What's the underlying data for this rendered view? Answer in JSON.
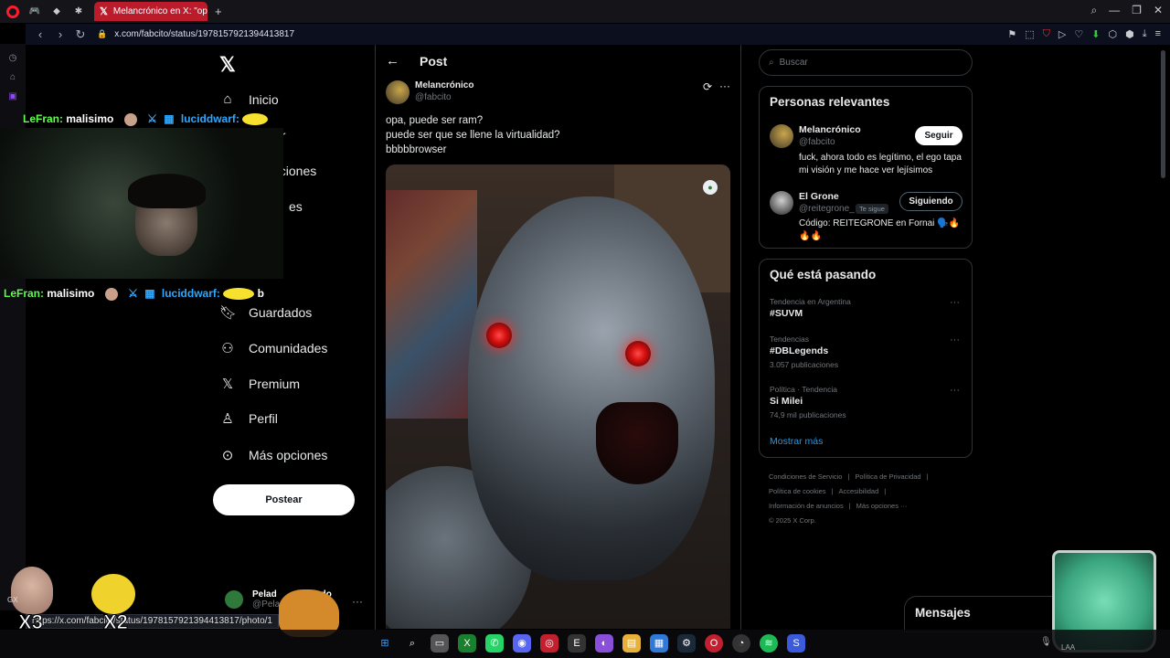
{
  "browser": {
    "tab_title": "Melancrónico en X: \"opa,",
    "url": "x.com/fabcito/status/1978157921394413817",
    "status_url": "https://x.com/fabcito/status/1978157921394413817/photo/1"
  },
  "x_nav": {
    "items": [
      {
        "label": "Inicio",
        "icon": "home-icon"
      },
      {
        "label": "Guardados",
        "icon": "bookmark-icon"
      },
      {
        "label": "Comunidades",
        "icon": "communities-icon"
      },
      {
        "label": "Premium",
        "icon": "x-icon"
      },
      {
        "label": "Perfil",
        "icon": "user-icon"
      },
      {
        "label": "Más opciones",
        "icon": "more-icon"
      }
    ],
    "partial_items": [
      "ar",
      "aciones",
      "es"
    ],
    "post_button": "Postear",
    "account_name": "Pelad",
    "account_name_tail": "astardo",
    "account_handle": "@Pelad",
    "account_handle_tail": "da"
  },
  "stream_overlay": {
    "chat1_user": "LeFran:",
    "chat1_msg": "malisimo",
    "chat1_user2": "luciddwarf:",
    "chat2_user": "LeFran:",
    "chat2_msg": "malisimo",
    "chat2_user2": "luciddwarf:",
    "chat2_tail": "b",
    "multiplier_a": "X3",
    "multiplier_b": "X2",
    "gx": "GX"
  },
  "post": {
    "header": "Post",
    "author_name": "Melancrónico",
    "author_handle": "@fabcito",
    "text_lines": [
      "opa, puede ser ram?",
      "puede ser que se llene la virtualidad?",
      "bbbbbrowser"
    ]
  },
  "sidebar": {
    "search_placeholder": "Buscar",
    "relevant_title": "Personas relevantes",
    "people": [
      {
        "name": "Melancrónico",
        "handle": "@fabcito",
        "bio": "fuck, ahora todo es legítimo, el ego tapa mi visión y me hace ver lejísimos",
        "button": "Seguir"
      },
      {
        "name": "El Grone",
        "handle": "@reitegrone_",
        "tag": "Te sigue",
        "bio": "Código: REITEGRONE en Fornai 🗣️🔥🔥🔥",
        "button": "Siguiendo"
      }
    ],
    "trending_title": "Qué está pasando",
    "trends": [
      {
        "context": "Tendencia en Argentina",
        "name": "#SUVM",
        "count": ""
      },
      {
        "context": "Tendencias",
        "name": "#DBLegends",
        "count": "3.057 publicaciones"
      },
      {
        "context": "Política · Tendencia",
        "name": "Si Milei",
        "count": "74,9 mil publicaciones"
      }
    ],
    "show_more": "Mostrar más",
    "footer": [
      "Condiciones de Servicio",
      "|",
      "Política de Privacidad",
      "|",
      "Política de cookies",
      "|",
      "Accesibilidad",
      "|",
      "Información de anuncios",
      "|",
      "Más opciones ···",
      "© 2025 X Corp."
    ],
    "messages": "Mensajes"
  },
  "taskbar": {
    "lang": "LAA"
  }
}
